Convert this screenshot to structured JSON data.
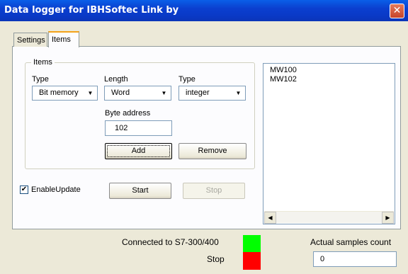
{
  "window": {
    "title": "Data logger for IBHSoftec Link by",
    "close_glyph": "✕"
  },
  "tabs": [
    {
      "label": "Settings"
    },
    {
      "label": "Items"
    }
  ],
  "items_group": {
    "label": "Items",
    "type_label": "Type",
    "type_value": "Bit memory",
    "length_label": "Length",
    "length_value": "Word",
    "type2_label": "Type",
    "type2_value": "integer",
    "byte_address_label": "Byte address",
    "byte_address_value": "102",
    "add_label": "Add",
    "remove_label": "Remove"
  },
  "enable_update": {
    "label": "EnableUpdate",
    "checked_glyph": "✔"
  },
  "start_label": "Start",
  "stop_button_label": "Stop",
  "list": {
    "items": [
      "MW100",
      "MW102"
    ]
  },
  "status": {
    "connected_text": "Connected to S7-300/400",
    "connected_color": "#00ff00",
    "stop_text": "Stop",
    "stop_color": "#ff0000",
    "samples_label": "Actual samples count",
    "samples_value": "0"
  },
  "icons": {
    "dropdown": "▼",
    "scroll_left": "◀",
    "scroll_right": "▶"
  }
}
